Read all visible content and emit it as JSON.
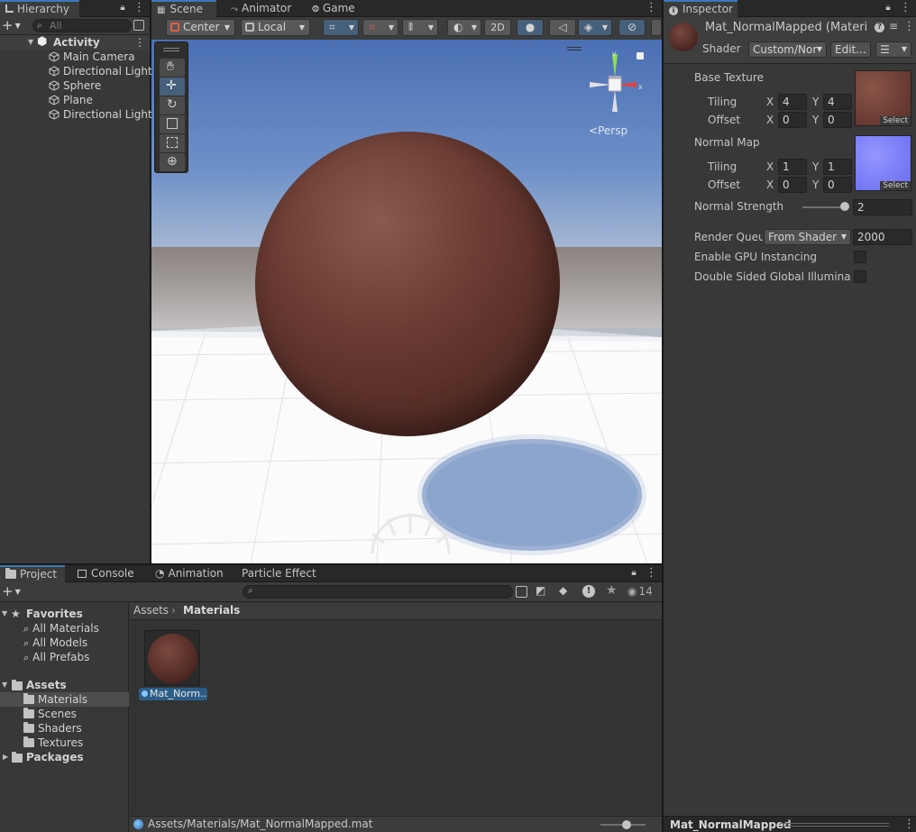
{
  "hierarchy": {
    "tab": "Hierarchy",
    "search_placeholder": "All",
    "scene_name": "Activity",
    "items": [
      "Main Camera",
      "Directional Light",
      "Sphere",
      "Plane",
      "Directional Light"
    ]
  },
  "scene_view": {
    "tabs": [
      "Scene",
      "Animator",
      "Game"
    ],
    "pivot": "Center",
    "space": "Local",
    "mode_2d": "2D",
    "projection_label": "Persp",
    "tools": [
      "hand-tool",
      "move-tool",
      "rotate-tool",
      "scale-tool",
      "rect-tool",
      "transform-tool"
    ]
  },
  "inspector": {
    "tab": "Inspector",
    "material_name": "Mat_NormalMapped (Materia",
    "shader_label": "Shader",
    "shader_value": "Custom/Nor",
    "edit_button": "Edit...",
    "base_texture": {
      "label": "Base Texture",
      "tiling_label": "Tiling",
      "offset_label": "Offset",
      "tiling_x": "4",
      "tiling_y": "4",
      "offset_x": "0",
      "offset_y": "0",
      "select": "Select"
    },
    "normal_map": {
      "label": "Normal Map",
      "tiling_label": "Tiling",
      "offset_label": "Offset",
      "tiling_x": "1",
      "tiling_y": "1",
      "offset_x": "0",
      "offset_y": "0",
      "select": "Select"
    },
    "axis_x": "X",
    "axis_y": "Y",
    "normal_strength_label": "Normal Strength",
    "normal_strength_value": "2",
    "render_queue_label": "Render Queu",
    "render_queue_mode": "From Shader",
    "render_queue_value": "2000",
    "gpu_instancing_label": "Enable GPU Instancing",
    "double_sided_label": "Double Sided Global Illuminatio",
    "footer_name": "Mat_NormalMapped"
  },
  "project": {
    "tabs": [
      "Project",
      "Console",
      "Animation",
      "Particle Effect"
    ],
    "hidden_count": "14",
    "breadcrumb_root": "Assets",
    "breadcrumb_current": "Materials",
    "favorites_label": "Favorites",
    "favorites": [
      "All Materials",
      "All Models",
      "All Prefabs"
    ],
    "assets_label": "Assets",
    "asset_folders": [
      "Materials",
      "Scenes",
      "Shaders",
      "Textures"
    ],
    "packages_label": "Packages",
    "asset_item_label": "Mat_Norm...",
    "status_path": "Assets/Materials/Mat_NormalMapped.mat"
  },
  "colors": {
    "accent": "#3a79bb",
    "selection": "#2c5d87",
    "panel": "#383838",
    "sphere": "#6a3b32",
    "sky_top": "#4a6fb3",
    "normal_map": "#7b7ef6"
  }
}
